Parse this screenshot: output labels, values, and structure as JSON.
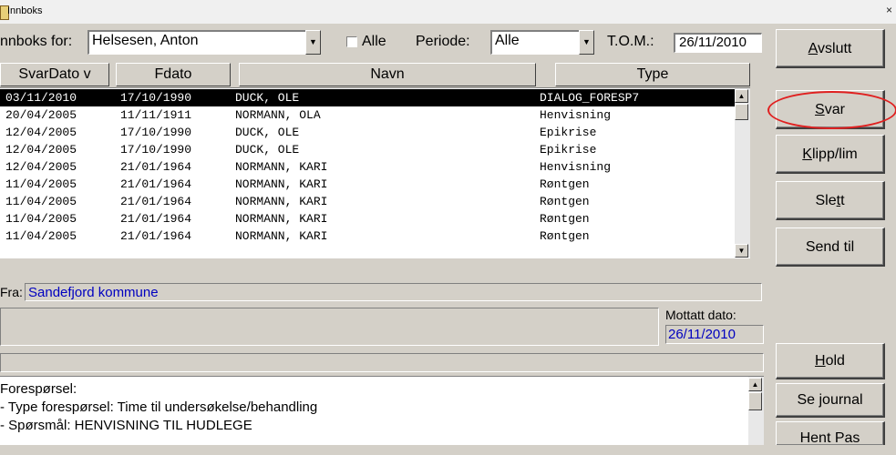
{
  "window": {
    "title": "Innboks",
    "close_glyph": "×"
  },
  "filter": {
    "innboks_label": "nnboks for:",
    "person_value": "Helsesen, Anton",
    "alle_checkbox_label": "Alle",
    "periode_label": "Periode:",
    "periode_value": "Alle",
    "tom_label": "T.O.M.:",
    "tom_value": "26/11/2010",
    "combo_arrow": "▼"
  },
  "columns": [
    "SvarDato  v",
    "Fdato",
    "Navn",
    "Type"
  ],
  "rows": [
    {
      "svardato": "03/11/2010",
      "fdato": "17/10/1990",
      "navn": "DUCK, OLE",
      "type": "DIALOG_FORESP7",
      "selected": true
    },
    {
      "svardato": "20/04/2005",
      "fdato": "11/11/1911",
      "navn": "NORMANN, OLA",
      "type": "Henvisning"
    },
    {
      "svardato": "12/04/2005",
      "fdato": "17/10/1990",
      "navn": "DUCK, OLE",
      "type": "Epikrise"
    },
    {
      "svardato": "12/04/2005",
      "fdato": "17/10/1990",
      "navn": "DUCK, OLE",
      "type": "Epikrise"
    },
    {
      "svardato": "12/04/2005",
      "fdato": "21/01/1964",
      "navn": "NORMANN, KARI",
      "type": "Henvisning"
    },
    {
      "svardato": "11/04/2005",
      "fdato": "21/01/1964",
      "navn": "NORMANN, KARI",
      "type": "Røntgen"
    },
    {
      "svardato": "11/04/2005",
      "fdato": "21/01/1964",
      "navn": "NORMANN, KARI",
      "type": "Røntgen"
    },
    {
      "svardato": "11/04/2005",
      "fdato": "21/01/1964",
      "navn": "NORMANN, KARI",
      "type": "Røntgen"
    },
    {
      "svardato": "11/04/2005",
      "fdato": "21/01/1964",
      "navn": "NORMANN, KARI",
      "type": "Røntgen"
    }
  ],
  "scroll": {
    "up": "▲",
    "down": "▼"
  },
  "details": {
    "fra_label": "Fra:",
    "fra_value": "Sandefjord kommune",
    "mottatt_label": "Mottatt dato:",
    "mottatt_value": "26/11/2010"
  },
  "message_lines": [
    "Forespørsel:",
    "- Type forespørsel: Time til undersøkelse/behandling",
    "- Spørsmål: HENVISNING TIL HUDLEGE"
  ],
  "buttons": {
    "avslutt": {
      "pre": "",
      "u": "A",
      "post": "vslutt"
    },
    "svar": {
      "pre": "",
      "u": "S",
      "post": "var"
    },
    "klipp": {
      "pre": "",
      "u": "K",
      "post": "lipp/lim"
    },
    "slett": {
      "pre": "Sle",
      "u": "t",
      "post": "t"
    },
    "send": {
      "pre": "Send til",
      "u": "",
      "post": ""
    },
    "hold": {
      "pre": "",
      "u": "H",
      "post": "old"
    },
    "journal": {
      "pre": "Se journal",
      "u": "",
      "post": ""
    },
    "hentpas": {
      "pre": "Hent Pas",
      "u": "",
      "post": ""
    }
  },
  "colors": {
    "selection": "#000000",
    "link_blue": "#0000c0",
    "highlight_ring": "#e02020"
  }
}
